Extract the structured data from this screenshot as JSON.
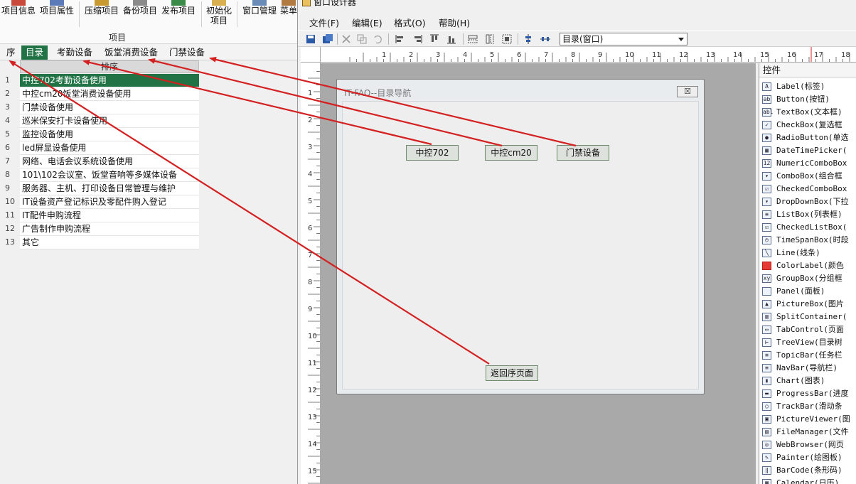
{
  "ribbon": {
    "buttons": [
      {
        "label": "项目信息"
      },
      {
        "label": "项目属性"
      },
      {
        "label": "压缩项目"
      },
      {
        "label": "备份项目"
      },
      {
        "label": "发布项目"
      },
      {
        "label": "初始化",
        "label2": "项目"
      },
      {
        "label": "窗口管理"
      },
      {
        "label": "菜单"
      }
    ],
    "group_label": "项目"
  },
  "tabs": [
    "序",
    "目录",
    "考勤设备",
    "饭堂消费设备",
    "门禁设备"
  ],
  "table": {
    "header": "排序",
    "rows": [
      {
        "num": "1",
        "text": "中控702考勤设备使用"
      },
      {
        "num": "2",
        "text": "中控cm20饭堂消费设备使用"
      },
      {
        "num": "3",
        "text": "门禁设备使用"
      },
      {
        "num": "4",
        "text": "巡米保安打卡设备使用"
      },
      {
        "num": "5",
        "text": "监控设备使用"
      },
      {
        "num": "6",
        "text": "led屏显设备使用"
      },
      {
        "num": "7",
        "text": "网络、电话会议系统设备使用"
      },
      {
        "num": "8",
        "text": "101\\102会议室、饭堂音响等多媒体设备"
      },
      {
        "num": "9",
        "text": "服务器、主机、打印设备日常管理与维护"
      },
      {
        "num": "10",
        "text": "IT设备资产登记标识及零配件购入登记"
      },
      {
        "num": "11",
        "text": "IT配件申购流程"
      },
      {
        "num": "12",
        "text": "广告制作申购流程"
      },
      {
        "num": "13",
        "text": "其它"
      }
    ]
  },
  "designer": {
    "title": "窗口设计器",
    "menus": [
      "文件(F)",
      "编辑(E)",
      "格式(O)",
      "帮助(H)"
    ],
    "combo_value": "目录(窗口)",
    "hruler_labels": [
      "1",
      "2",
      "3",
      "4",
      "5",
      "6",
      "7",
      "8",
      "9",
      "10",
      "11",
      "12",
      "13",
      "14",
      "15",
      "16",
      "17",
      "18"
    ],
    "vruler_labels": [
      "1",
      "2",
      "3",
      "4",
      "5",
      "6",
      "7",
      "8",
      "9",
      "10",
      "11",
      "12",
      "13",
      "14",
      "15",
      "16"
    ],
    "form": {
      "title": "IT-FAQ--目录导航",
      "close_glyph": "☒",
      "buttons": [
        "中控702",
        "中控cm20",
        "门禁设备",
        "返回序页面"
      ]
    }
  },
  "controls": {
    "title": "控件",
    "items": [
      {
        "icon": "A",
        "label": "Label(标签)"
      },
      {
        "icon": "ab",
        "label": "Button(按钮)"
      },
      {
        "icon": "abl",
        "label": "TextBox(文本框)"
      },
      {
        "icon": "✓",
        "label": "CheckBox(复选框"
      },
      {
        "icon": "●",
        "label": "RadioButton(单选"
      },
      {
        "icon": "▦",
        "label": "DateTimePicker("
      },
      {
        "icon": "12",
        "label": "NumericComboBox"
      },
      {
        "icon": "▾",
        "label": "ComboBox(组合框"
      },
      {
        "icon": "☑",
        "label": "CheckedComboBox"
      },
      {
        "icon": "▾",
        "label": "DropDownBox(下拉"
      },
      {
        "icon": "≡",
        "label": "ListBox(列表框)"
      },
      {
        "icon": "☑",
        "label": "CheckedListBox("
      },
      {
        "icon": "◷",
        "label": "TimeSpanBox(时段"
      },
      {
        "icon": "╲",
        "label": "Line(线条)"
      },
      {
        "icon": "",
        "label": "ColorLabel(颜色"
      },
      {
        "icon": "xy",
        "label": "GroupBox(分组框"
      },
      {
        "icon": "",
        "label": "Panel(面板)"
      },
      {
        "icon": "▲",
        "label": "PictureBox(图片"
      },
      {
        "icon": "▥",
        "label": "SplitContainer("
      },
      {
        "icon": "▭",
        "label": "TabControl(页面"
      },
      {
        "icon": "⊢",
        "label": "TreeView(目录树"
      },
      {
        "icon": "≡",
        "label": "TopicBar(任务栏"
      },
      {
        "icon": "≡",
        "label": "NavBar(导航栏)"
      },
      {
        "icon": "▮",
        "label": "Chart(图表)"
      },
      {
        "icon": "▬",
        "label": "ProgressBar(进度"
      },
      {
        "icon": "○",
        "label": "TrackBar(滑动条"
      },
      {
        "icon": "▣",
        "label": "PictureViewer(图"
      },
      {
        "icon": "▤",
        "label": "FileManager(文件"
      },
      {
        "icon": "◎",
        "label": "WebBrowser(网页"
      },
      {
        "icon": "✎",
        "label": "Painter(绘图板)"
      },
      {
        "icon": "‖",
        "label": "BarCode(条形码)"
      },
      {
        "icon": "▦",
        "label": "Calendar(日历)"
      }
    ]
  },
  "colors": {
    "accent_green": "#217346",
    "arrow_red": "#d42020",
    "color_label_red": "#e53935"
  }
}
